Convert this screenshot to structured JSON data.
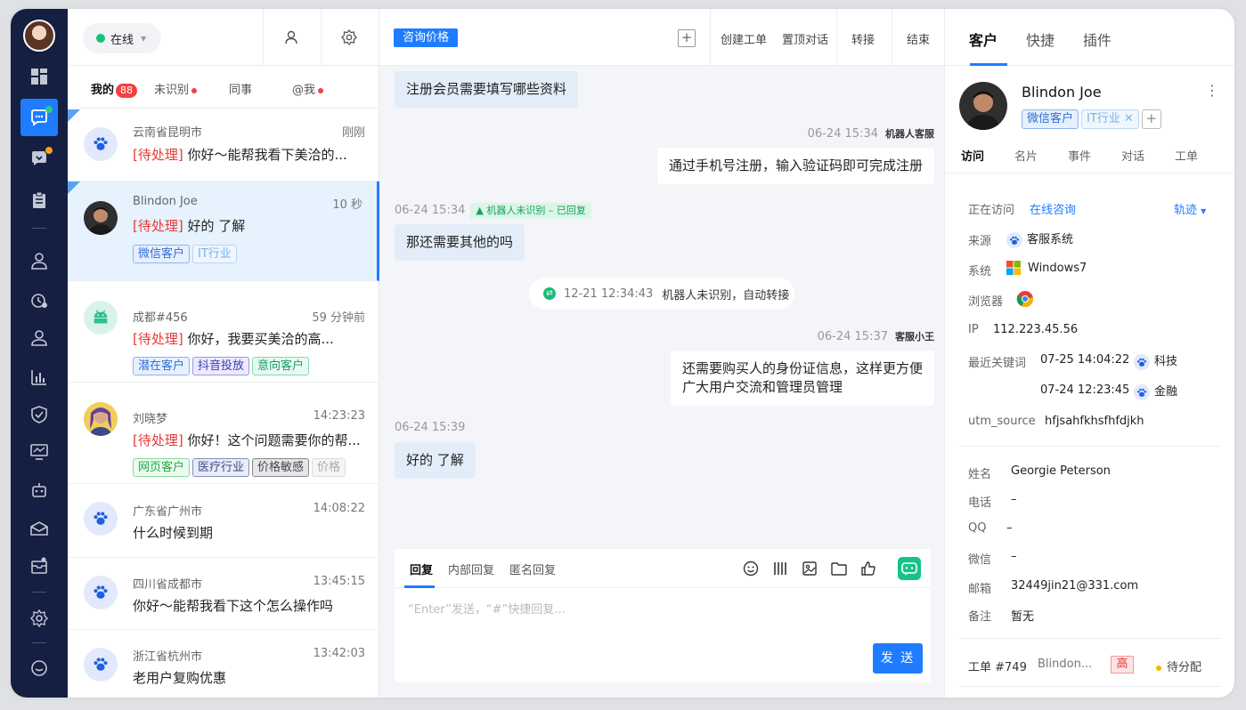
{
  "agent": {
    "status": "在线"
  },
  "list_tabs": {
    "mine": "我的",
    "mine_count": "88",
    "unidentified": "未识别",
    "colleagues": "同事",
    "mentions": "@我"
  },
  "conversations": [
    {
      "name": "云南省昆明市",
      "time": "刚刚",
      "pending": "[待处理]",
      "message": "你好～能帮我看下美洽的...",
      "tags": []
    },
    {
      "name": "Blindon Joe",
      "time": "10 秒",
      "pending": "[待处理]",
      "message": "好的 了解",
      "tags": [
        "微信客户",
        "IT行业"
      ]
    },
    {
      "name": "成都#456",
      "time": "59 分钟前",
      "pending": "[待处理]",
      "message": "你好，我要买美洽的高...",
      "tags": [
        "潜在客户",
        "抖音投放",
        "意向客户"
      ]
    },
    {
      "name": "刘晓梦",
      "time": "14:23:23",
      "pending": "[待处理]",
      "message": "你好！这个问题需要你的帮...",
      "tags": [
        "网页客户",
        "医疗行业",
        "价格敏感",
        "价格"
      ]
    },
    {
      "name": "广东省广州市",
      "time": "14:08:22",
      "pending": "",
      "message": "什么时候到期",
      "tags": []
    },
    {
      "name": "四川省成都市",
      "time": "13:45:15",
      "pending": "",
      "message": "你好～能帮我看下这个怎么操作吗",
      "tags": []
    },
    {
      "name": "浙江省杭州市",
      "time": "13:42:03",
      "pending": "",
      "message": "老用户复购优惠",
      "tags": []
    }
  ],
  "chat_toolbar": {
    "topic_chip": "咨询价格",
    "create_ticket": "创建工单",
    "pin_chat": "置顶对话",
    "transfer": "转接",
    "end": "结束"
  },
  "messages": {
    "m1": "注册会员需要填写哪些资料",
    "m2_meta": "06-24 15:34",
    "m2_sender": "机器人客服",
    "m2": "通过手机号注册，输入验证码即可完成注册",
    "m3_meta": "06-24 15:34",
    "m3_tag": "机器人未识别 – 已回复",
    "m3": "那还需要其他的吗",
    "sys_time": "12-21 12:34:43",
    "sys_text": "机器人未识别，自动转接",
    "m4_meta": "06-24 15:37",
    "m4_sender": "客服小王",
    "m4_line1": "还需要购买人的身份证信息，这样更方便",
    "m4_line2": "广大用户交流和管理员管理",
    "m5_meta": "06-24 15:39",
    "m5": "好的 了解"
  },
  "reply": {
    "tab_reply": "回复",
    "tab_internal": "内部回复",
    "tab_anonymous": "匿名回复",
    "placeholder": "“Enter”发送，“#”快捷回复…",
    "send": "发 送"
  },
  "info_tabs": {
    "customer": "客户",
    "shortcut": "快捷",
    "plugin": "插件"
  },
  "customer": {
    "name": "Blindon Joe",
    "tags": [
      "微信客户",
      "IT行业"
    ],
    "subtabs": [
      "访问",
      "名片",
      "事件",
      "对话",
      "工单"
    ],
    "visiting_label": "正在访问",
    "visiting_value": "在线咨询",
    "track": "轨迹",
    "source_label": "来源",
    "source_value": "客服系统",
    "os_label": "系统",
    "os_value": "Windows7",
    "browser_label": "浏览器",
    "ip_label": "IP",
    "ip_value": "112.223.45.56",
    "keyword_label": "最近关键词",
    "kw1_time": "07-25 14:04:22",
    "kw1": "科技",
    "kw2_time": "07-24 12:23:45",
    "kw2": "金融",
    "utm_label": "utm_source",
    "utm_value": "hfjsahfkhsfhfdjkh",
    "fullname_label": "姓名",
    "fullname_value": "Georgie Peterson",
    "phone_label": "电话",
    "phone_value": "–",
    "qq_label": "QQ",
    "qq_value": "–",
    "wechat_label": "微信",
    "wechat_value": "–",
    "email_label": "邮箱",
    "email_value": "32449jin21@331.com",
    "note_label": "备注",
    "note_value": "暂无",
    "ticket_label": "工单 #749",
    "ticket_name": "Blindon...",
    "ticket_priority": "高",
    "ticket_status": "待分配"
  },
  "colors": {
    "accent": "#1f7cff",
    "nav_bg": "#141f42",
    "pending": "#e53935",
    "online": "#17c176"
  }
}
